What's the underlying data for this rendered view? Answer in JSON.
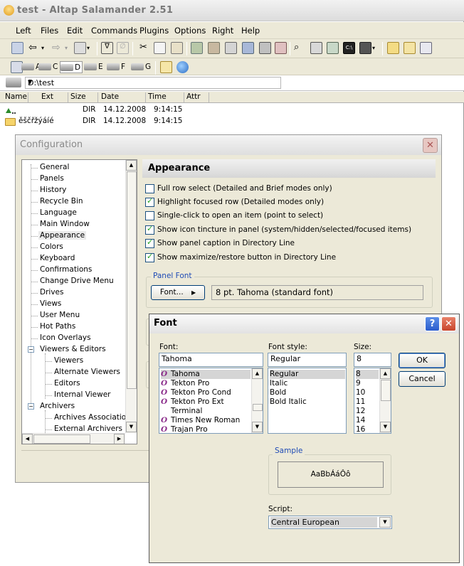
{
  "window": {
    "title": "test - Altap Salamander 2.51"
  },
  "menu": [
    "Left",
    "Files",
    "Edit",
    "Commands",
    "Plugins",
    "Options",
    "Right",
    "Help"
  ],
  "drives": [
    {
      "letter": "A",
      "selected": false
    },
    {
      "letter": "C",
      "selected": false
    },
    {
      "letter": "D",
      "selected": true
    },
    {
      "letter": "E",
      "selected": false
    },
    {
      "letter": "F",
      "selected": false
    },
    {
      "letter": "G",
      "selected": false
    }
  ],
  "path": "D:\\test",
  "columns": {
    "name": "Name",
    "ext": "Ext",
    "size": "Size",
    "date": "Date",
    "time": "Time",
    "attr": "Attr"
  },
  "files": [
    {
      "name": "..",
      "size": "DIR",
      "date": "14.12.2008",
      "time": "9:14:15"
    },
    {
      "name": "ěščřžýáíé",
      "size": "DIR",
      "date": "14.12.2008",
      "time": "9:14:15"
    }
  ],
  "config": {
    "title": "Configuration",
    "close": "✕",
    "tree_top": [
      "General",
      "Panels",
      "History",
      "Recycle Bin",
      "Language",
      "Main Window",
      "Appearance",
      "Colors",
      "Keyboard",
      "Confirmations",
      "Change Drive Menu",
      "Drives",
      "Views",
      "User Menu",
      "Hot Paths",
      "Icon Overlays"
    ],
    "tree_viewers": {
      "label": "Viewers & Editors",
      "children": [
        "Viewers",
        "Alternate Viewers",
        "Editors",
        "Internal Viewer"
      ]
    },
    "tree_archivers": {
      "label": "Archivers",
      "children": [
        "Archives Associations",
        "External Archivers Lo..."
      ]
    },
    "page_title": "Appearance",
    "options": [
      {
        "label": "Full row select (Detailed and Brief modes only)",
        "checked": false
      },
      {
        "label": "Highlight focused row (Detailed modes only)",
        "checked": true
      },
      {
        "label": "Single-click to open an item (point to select)",
        "checked": false
      },
      {
        "label": "Show icon tincture in panel (system/hidden/selected/focused items)",
        "checked": true
      },
      {
        "label": "Show panel caption in Directory Line",
        "checked": true
      },
      {
        "label": "Show maximize/restore button in Directory Line",
        "checked": true
      }
    ],
    "panel_font": {
      "group_label": "Panel Font",
      "button": "Font...",
      "value": "8 pt. Tahoma (standard font)"
    }
  },
  "font_dialog": {
    "title": "Font",
    "help": "?",
    "close": "✕",
    "font_label": "Font:",
    "font_value": "Tahoma",
    "fonts": [
      "Tahoma",
      "Tekton Pro",
      "Tekton Pro Cond",
      "Tekton Pro Ext",
      "Terminal",
      "Times New Roman",
      "Trajan Pro"
    ],
    "style_label": "Font style:",
    "style_value": "Regular",
    "styles": [
      "Regular",
      "Italic",
      "Bold",
      "Bold Italic"
    ],
    "size_label": "Size:",
    "size_value": "8",
    "sizes": [
      "8",
      "9",
      "10",
      "11",
      "12",
      "14",
      "16"
    ],
    "ok": "OK",
    "cancel": "Cancel",
    "sample_label": "Sample",
    "sample_text": "AaBbÁáÔô",
    "script_label": "Script:",
    "script_value": "Central European",
    "accent": "#1f4bb5"
  }
}
